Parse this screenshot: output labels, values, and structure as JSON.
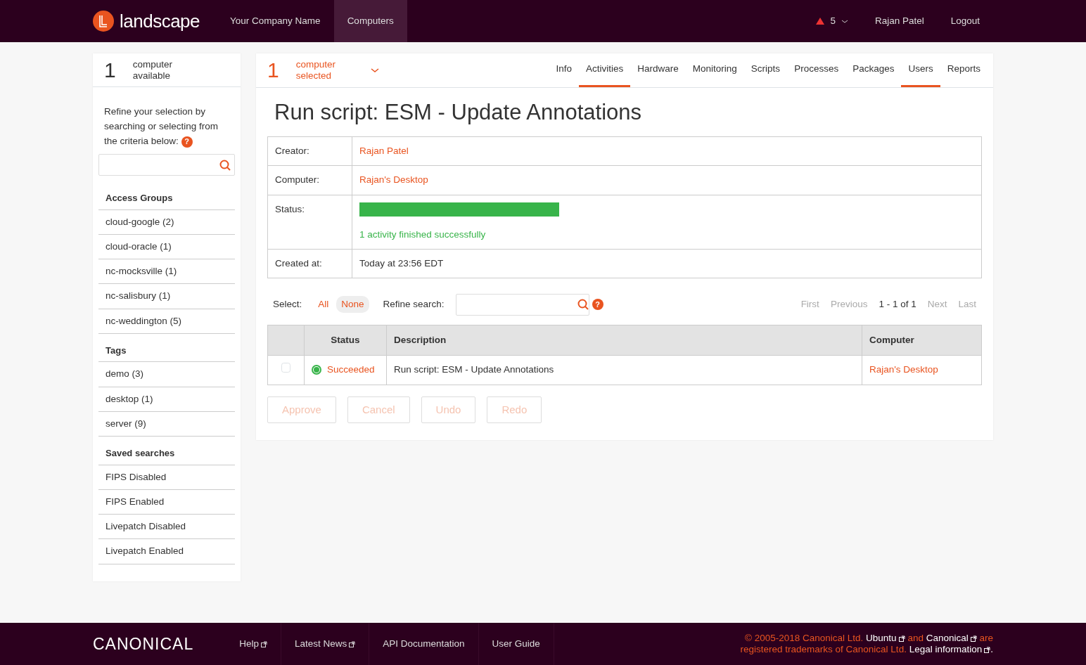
{
  "header": {
    "logo": "landscape",
    "nav": [
      {
        "label": "Your Company Name",
        "selected": false
      },
      {
        "label": "Computers",
        "selected": true
      }
    ],
    "alerts": "5",
    "user": "Rajan Patel",
    "logout": "Logout"
  },
  "sidebar": {
    "count": "1",
    "count_label": "computer available",
    "intro": "Refine your selection by searching or selecting from the criteria below:",
    "help": "?",
    "sections": [
      {
        "title": "Access Groups",
        "items": [
          "cloud-google (2)",
          "cloud-oracle (1)",
          "nc-mocksville (1)",
          "nc-salisbury (1)",
          "nc-weddington (5)"
        ]
      },
      {
        "title": "Tags",
        "items": [
          "demo (3)",
          "desktop (1)",
          "server (9)"
        ]
      },
      {
        "title": "Saved searches",
        "items": [
          "FIPS Disabled",
          "FIPS Enabled",
          "Livepatch Disabled",
          "Livepatch Enabled"
        ]
      }
    ]
  },
  "main": {
    "count": "1",
    "count_label": "computer selected",
    "tabs": [
      {
        "label": "Info",
        "selected": false
      },
      {
        "label": "Activities",
        "selected": true
      },
      {
        "label": "Hardware",
        "selected": false
      },
      {
        "label": "Monitoring",
        "selected": false
      },
      {
        "label": "Scripts",
        "selected": false
      },
      {
        "label": "Processes",
        "selected": false
      },
      {
        "label": "Packages",
        "selected": false
      },
      {
        "label": "Users",
        "selected": true
      },
      {
        "label": "Reports",
        "selected": false
      }
    ],
    "title": "Run script: ESM - Update Annotations",
    "details": [
      {
        "label": "Creator:",
        "kind": "link",
        "value": "Rajan Patel"
      },
      {
        "label": "Computer:",
        "kind": "link",
        "value": "Rajan's Desktop"
      },
      {
        "label": "Status:",
        "kind": "progress",
        "level": 1,
        "value": "1 activity finished successfully"
      },
      {
        "label": "Created at:",
        "kind": "text",
        "value": "Today at 23:56 EDT"
      }
    ],
    "select_label": "Select:",
    "select_options": [
      {
        "label": "All",
        "selected": false
      },
      {
        "label": "None",
        "selected": true
      }
    ],
    "refine_label": "Refine search:",
    "refine_help": "?",
    "pager": {
      "first": "First",
      "previous": "Previous",
      "range": "1 - 1 of 1",
      "next": "Next",
      "last": "Last"
    },
    "table": {
      "columns": [
        "Status",
        "Description",
        "Computer"
      ],
      "rows": [
        {
          "checked": false,
          "status": "Succeeded",
          "description": "Run script: ESM - Update Annotations",
          "computer": "Rajan's Desktop"
        }
      ]
    },
    "buttons": [
      {
        "label": "Approve",
        "disabled": true
      },
      {
        "label": "Cancel",
        "disabled": true
      },
      {
        "label": "Undo",
        "disabled": true
      },
      {
        "label": "Redo",
        "disabled": true
      }
    ]
  },
  "footer": {
    "logo": "CANONICAL",
    "links": [
      {
        "label": "Help",
        "external": true
      },
      {
        "label": "Latest News",
        "external": true
      },
      {
        "label": "API Documentation",
        "external": false
      },
      {
        "label": "User Guide",
        "external": false
      }
    ],
    "legal": [
      {
        "kind": "text",
        "text": "© 2005-2018 Canonical Ltd."
      },
      {
        "kind": "link",
        "text": "Ubuntu"
      },
      {
        "kind": "text",
        "text": "and"
      },
      {
        "kind": "link",
        "text": "Canonical"
      },
      {
        "kind": "text",
        "text": "are registered trademarks of Canonical Ltd."
      },
      {
        "kind": "link",
        "text": "Legal information"
      }
    ],
    "legal_end": "."
  }
}
